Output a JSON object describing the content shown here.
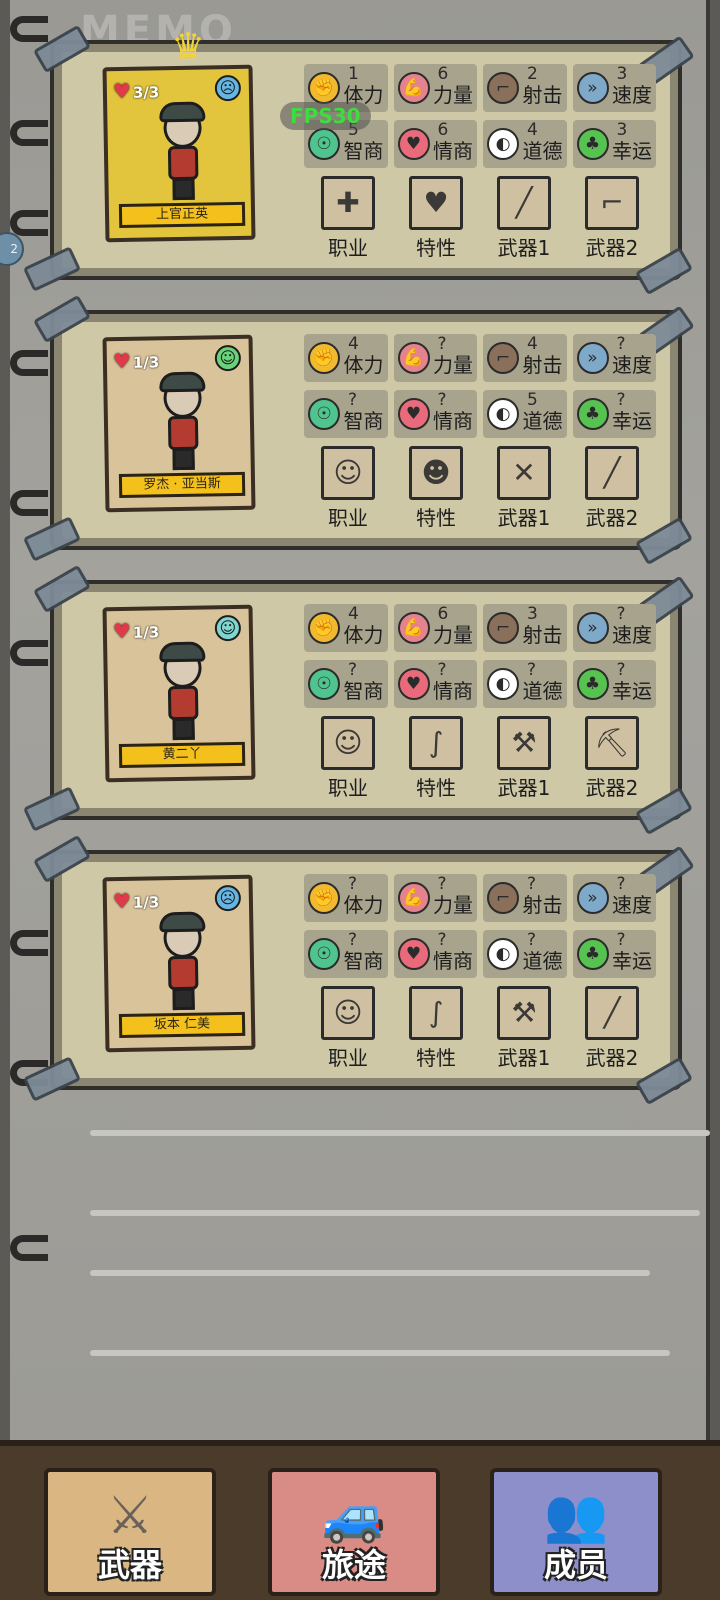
{
  "watermark": "MEMO",
  "fps_label": "FPS30",
  "side_badge": "2",
  "cards": [
    {
      "hp": "3/3",
      "mood": "sad",
      "name": "上官正英",
      "crown": true,
      "stats_row1": [
        {
          "label": "体力",
          "value": "1",
          "icon": "muscle-arm-icon"
        },
        {
          "label": "力量",
          "value": "6",
          "icon": "flexed-bicep-icon"
        },
        {
          "label": "射击",
          "value": "2",
          "icon": "pistol-icon"
        },
        {
          "label": "速度",
          "value": "3",
          "icon": "speed-boot-icon"
        }
      ],
      "stats_row2": [
        {
          "label": "智商",
          "value": "5",
          "icon": "brain-icon"
        },
        {
          "label": "情商",
          "value": "6",
          "icon": "heart-icon"
        },
        {
          "label": "道德",
          "value": "4",
          "icon": "mask-icon"
        },
        {
          "label": "幸运",
          "value": "3",
          "icon": "clover-icon"
        }
      ],
      "equipment": [
        {
          "label": "职业",
          "icon": "nurse-icon",
          "glyph": "✚"
        },
        {
          "label": "特性",
          "icon": "lips-icon",
          "glyph": "♥"
        },
        {
          "label": "武器1",
          "icon": "bat-icon",
          "glyph": "╱"
        },
        {
          "label": "武器2",
          "icon": "rifle-icon",
          "glyph": "⌐"
        }
      ]
    },
    {
      "hp": "1/3",
      "mood": "ok",
      "name": "罗杰 · 亚当斯",
      "crown": false,
      "stats_row1": [
        {
          "label": "体力",
          "value": "4",
          "icon": "muscle-arm-icon"
        },
        {
          "label": "力量",
          "value": "?",
          "icon": "flexed-bicep-icon"
        },
        {
          "label": "射击",
          "value": "4",
          "icon": "pistol-icon"
        },
        {
          "label": "速度",
          "value": "?",
          "icon": "speed-boot-icon"
        }
      ],
      "stats_row2": [
        {
          "label": "智商",
          "value": "?",
          "icon": "brain-icon"
        },
        {
          "label": "情商",
          "value": "?",
          "icon": "heart-icon"
        },
        {
          "label": "道德",
          "value": "5",
          "icon": "mask-icon"
        },
        {
          "label": "幸运",
          "value": "?",
          "icon": "clover-icon"
        }
      ],
      "equipment": [
        {
          "label": "职业",
          "icon": "surgeon-icon",
          "glyph": "☺"
        },
        {
          "label": "特性",
          "icon": "pig-face-icon",
          "glyph": "☻"
        },
        {
          "label": "武器1",
          "icon": "crossbow-icon",
          "glyph": "✕"
        },
        {
          "label": "武器2",
          "icon": "blade-icon",
          "glyph": "╱"
        }
      ]
    },
    {
      "hp": "1/3",
      "mood": "neutral",
      "name": "黄二丫",
      "crown": false,
      "stats_row1": [
        {
          "label": "体力",
          "value": "4",
          "icon": "muscle-arm-icon"
        },
        {
          "label": "力量",
          "value": "6",
          "icon": "flexed-bicep-icon"
        },
        {
          "label": "射击",
          "value": "3",
          "icon": "pistol-icon"
        },
        {
          "label": "速度",
          "value": "?",
          "icon": "speed-boot-icon"
        }
      ],
      "stats_row2": [
        {
          "label": "智商",
          "value": "?",
          "icon": "brain-icon"
        },
        {
          "label": "情商",
          "value": "?",
          "icon": "heart-icon"
        },
        {
          "label": "道德",
          "value": "?",
          "icon": "mask-icon"
        },
        {
          "label": "幸运",
          "value": "?",
          "icon": "clover-icon"
        }
      ],
      "equipment": [
        {
          "label": "职业",
          "icon": "glasses-man-icon",
          "glyph": "☺"
        },
        {
          "label": "特性",
          "icon": "arm-icon",
          "glyph": "∫"
        },
        {
          "label": "武器1",
          "icon": "wrench-icon",
          "glyph": "⚒"
        },
        {
          "label": "武器2",
          "icon": "pickaxe-icon",
          "glyph": "⛏"
        }
      ]
    },
    {
      "hp": "1/3",
      "mood": "sad",
      "name": "坂本 仁美",
      "crown": false,
      "stats_row1": [
        {
          "label": "体力",
          "value": "?",
          "icon": "muscle-arm-icon"
        },
        {
          "label": "力量",
          "value": "?",
          "icon": "flexed-bicep-icon"
        },
        {
          "label": "射击",
          "value": "?",
          "icon": "pistol-icon"
        },
        {
          "label": "速度",
          "value": "?",
          "icon": "speed-boot-icon"
        }
      ],
      "stats_row2": [
        {
          "label": "智商",
          "value": "?",
          "icon": "brain-icon"
        },
        {
          "label": "情商",
          "value": "?",
          "icon": "heart-icon"
        },
        {
          "label": "道德",
          "value": "?",
          "icon": "mask-icon"
        },
        {
          "label": "幸运",
          "value": "?",
          "icon": "clover-icon"
        }
      ],
      "equipment": [
        {
          "label": "职业",
          "icon": "glasses-man-icon",
          "glyph": "☺"
        },
        {
          "label": "特性",
          "icon": "arm-icon",
          "glyph": "∫"
        },
        {
          "label": "武器1",
          "icon": "wrench-icon",
          "glyph": "⚒"
        },
        {
          "label": "武器2",
          "icon": "knife-icon",
          "glyph": "╱"
        }
      ]
    }
  ],
  "nav": [
    {
      "label": "武器",
      "icon": "weapons-icon",
      "color": "#d9b682"
    },
    {
      "label": "旅途",
      "icon": "car-icon",
      "color": "#d98c86"
    },
    {
      "label": "成员",
      "icon": "members-icon",
      "color": "#8c8fc9"
    }
  ],
  "colors": {
    "stat_icons": [
      "#f0b930",
      "#e4838e",
      "#8a6f5a",
      "#7ea9c9",
      "#4fc48f",
      "#e96b7b",
      "#ffffff",
      "#56c24f"
    ]
  }
}
